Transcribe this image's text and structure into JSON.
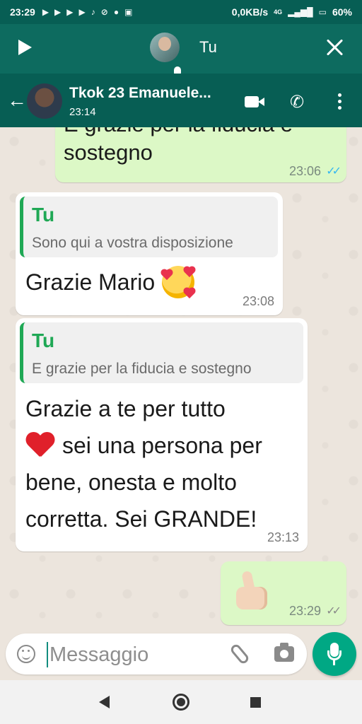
{
  "status_bar": {
    "time": "23:29",
    "notification_icons": [
      "play-store-icon",
      "play-store-icon",
      "play-store-icon",
      "play-store-icon",
      "tiktok-icon",
      "block-icon",
      "keyhole-icon",
      "youtube-icon"
    ],
    "speed": "0,0KB/s",
    "network": "4G",
    "battery": "60%"
  },
  "audio_player": {
    "sender": "Tu"
  },
  "chat_header": {
    "contact_name": "Tkok 23 Emanuele...",
    "subtitle": "23:14"
  },
  "messages": [
    {
      "direction": "outgoing",
      "text_line1": "E grazie per la fiducia e",
      "text_line2": "sostegno",
      "time": "23:06",
      "ticks": "✓✓",
      "tick_color": "#34b7f1"
    },
    {
      "direction": "incoming",
      "quote_author": "Tu",
      "quote_text": "Sono qui a vostra disposizione",
      "text": "Grazie Mario",
      "emoji": "smiling-face-with-hearts",
      "time": "23:08"
    },
    {
      "direction": "incoming",
      "quote_author": "Tu",
      "quote_text": "E grazie per la fiducia e sostegno",
      "line1": "Grazie a te per tutto",
      "line2": "sei una persona per",
      "line3": "bene, onesta e molto",
      "line4": "corretta. Sei GRANDE!",
      "emoji": "red-heart",
      "time": "23:13"
    },
    {
      "direction": "outgoing",
      "emoji": "thumbs-up",
      "time": "23:29",
      "ticks": "✓✓",
      "tick_color": "#8a8a8a"
    }
  ],
  "composer": {
    "placeholder": "Messaggio",
    "value": ""
  },
  "colors": {
    "header": "#075e54",
    "outgoing_bubble": "#dcf8c6",
    "accent": "#00a884",
    "quote_author": "#1fa855"
  }
}
